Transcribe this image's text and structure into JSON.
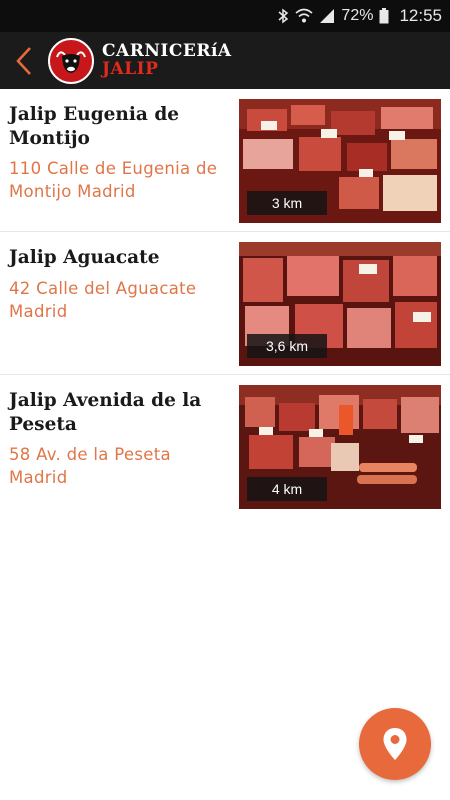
{
  "status_bar": {
    "battery": "72%",
    "time": "12:55",
    "icons": [
      "bluetooth-icon",
      "wifi-icon",
      "signal-icon",
      "battery-icon"
    ]
  },
  "header": {
    "brand_line1": "CARNICERíA",
    "brand_line2": "JALIP",
    "back_icon": "chevron-left-icon",
    "accent": "#e8693c"
  },
  "stores": [
    {
      "name": "Jalip Eugenia de Montijo",
      "address": "110 Calle de Eugenia de Montijo Madrid",
      "distance": "3 km"
    },
    {
      "name": "Jalip Aguacate",
      "address": "42 Calle del Aguacate Madrid",
      "distance": "3,6 km"
    },
    {
      "name": "Jalip Avenida de la Peseta",
      "address": "58 Av. de la Peseta Madrid",
      "distance": "4 km"
    }
  ],
  "fab": {
    "icon": "location-pin-icon",
    "color": "#e8693c"
  }
}
